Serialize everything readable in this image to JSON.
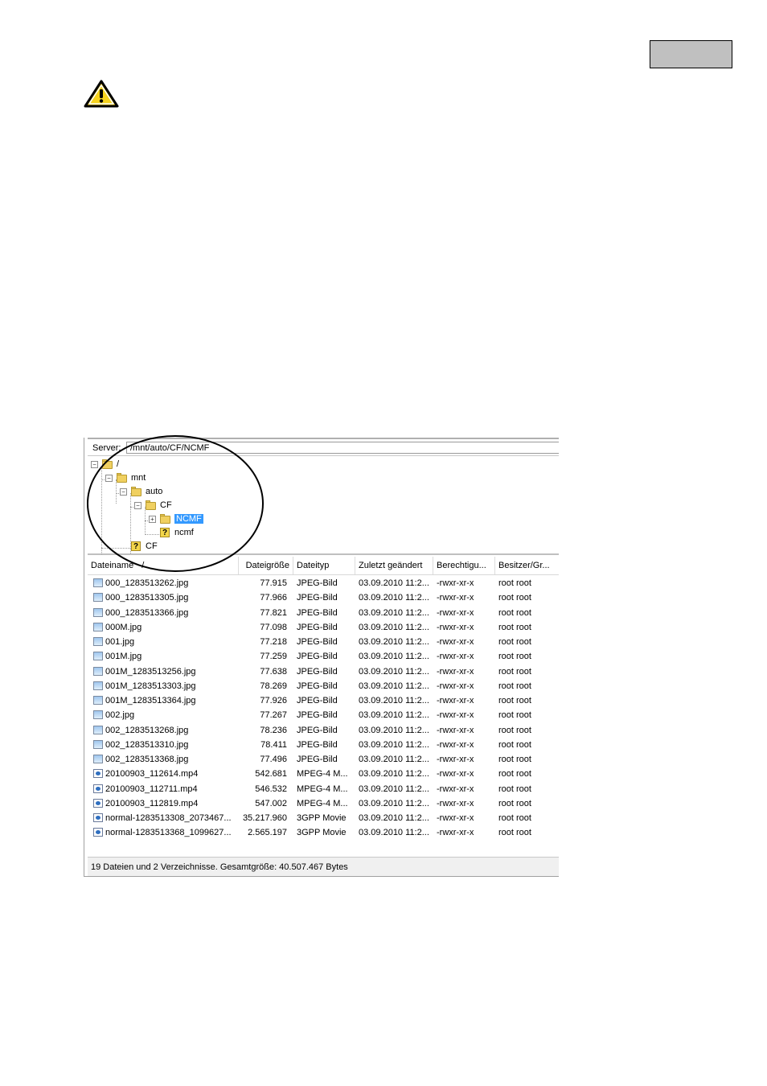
{
  "icons": {
    "warning": "warning-triangle-icon",
    "folder": "folder-icon",
    "unknown": "question-folder-icon",
    "image_file": "image-file-icon",
    "video_file": "video-file-icon"
  },
  "server": {
    "label": "Server:",
    "path": "/mnt/auto/CF/NCMF"
  },
  "tree": [
    {
      "label": "/",
      "icon": "folder"
    },
    {
      "label": "mnt",
      "icon": "folder"
    },
    {
      "label": "auto",
      "icon": "folder"
    },
    {
      "label": "CF",
      "icon": "folder"
    },
    {
      "label": "NCMF",
      "icon": "folder",
      "selected": true
    },
    {
      "label": "ncmf",
      "icon": "unknown"
    },
    {
      "label": "CF",
      "icon": "unknown"
    }
  ],
  "columns": [
    "Dateiname",
    "Dateigröße",
    "Dateityp",
    "Zuletzt geändert",
    "Berechtigu...",
    "Besitzer/Gr..."
  ],
  "sort_indicator": "/",
  "files": [
    {
      "name": "000_1283513262.jpg",
      "size": "77.915",
      "type": "JPEG-Bild",
      "modified": "03.09.2010 11:2...",
      "perm": "-rwxr-xr-x",
      "owner": "root root",
      "icon": "image"
    },
    {
      "name": "000_1283513305.jpg",
      "size": "77.966",
      "type": "JPEG-Bild",
      "modified": "03.09.2010 11:2...",
      "perm": "-rwxr-xr-x",
      "owner": "root root",
      "icon": "image"
    },
    {
      "name": "000_1283513366.jpg",
      "size": "77.821",
      "type": "JPEG-Bild",
      "modified": "03.09.2010 11:2...",
      "perm": "-rwxr-xr-x",
      "owner": "root root",
      "icon": "image"
    },
    {
      "name": "000M.jpg",
      "size": "77.098",
      "type": "JPEG-Bild",
      "modified": "03.09.2010 11:2...",
      "perm": "-rwxr-xr-x",
      "owner": "root root",
      "icon": "image"
    },
    {
      "name": "001.jpg",
      "size": "77.218",
      "type": "JPEG-Bild",
      "modified": "03.09.2010 11:2...",
      "perm": "-rwxr-xr-x",
      "owner": "root root",
      "icon": "image"
    },
    {
      "name": "001M.jpg",
      "size": "77.259",
      "type": "JPEG-Bild",
      "modified": "03.09.2010 11:2...",
      "perm": "-rwxr-xr-x",
      "owner": "root root",
      "icon": "image"
    },
    {
      "name": "001M_1283513256.jpg",
      "size": "77.638",
      "type": "JPEG-Bild",
      "modified": "03.09.2010 11:2...",
      "perm": "-rwxr-xr-x",
      "owner": "root root",
      "icon": "image"
    },
    {
      "name": "001M_1283513303.jpg",
      "size": "78.269",
      "type": "JPEG-Bild",
      "modified": "03.09.2010 11:2...",
      "perm": "-rwxr-xr-x",
      "owner": "root root",
      "icon": "image"
    },
    {
      "name": "001M_1283513364.jpg",
      "size": "77.926",
      "type": "JPEG-Bild",
      "modified": "03.09.2010 11:2...",
      "perm": "-rwxr-xr-x",
      "owner": "root root",
      "icon": "image"
    },
    {
      "name": "002.jpg",
      "size": "77.267",
      "type": "JPEG-Bild",
      "modified": "03.09.2010 11:2...",
      "perm": "-rwxr-xr-x",
      "owner": "root root",
      "icon": "image"
    },
    {
      "name": "002_1283513268.jpg",
      "size": "78.236",
      "type": "JPEG-Bild",
      "modified": "03.09.2010 11:2...",
      "perm": "-rwxr-xr-x",
      "owner": "root root",
      "icon": "image"
    },
    {
      "name": "002_1283513310.jpg",
      "size": "78.411",
      "type": "JPEG-Bild",
      "modified": "03.09.2010 11:2...",
      "perm": "-rwxr-xr-x",
      "owner": "root root",
      "icon": "image"
    },
    {
      "name": "002_1283513368.jpg",
      "size": "77.496",
      "type": "JPEG-Bild",
      "modified": "03.09.2010 11:2...",
      "perm": "-rwxr-xr-x",
      "owner": "root root",
      "icon": "image"
    },
    {
      "name": "20100903_112614.mp4",
      "size": "542.681",
      "type": "MPEG-4 M...",
      "modified": "03.09.2010 11:2...",
      "perm": "-rwxr-xr-x",
      "owner": "root root",
      "icon": "video"
    },
    {
      "name": "20100903_112711.mp4",
      "size": "546.532",
      "type": "MPEG-4 M...",
      "modified": "03.09.2010 11:2...",
      "perm": "-rwxr-xr-x",
      "owner": "root root",
      "icon": "video"
    },
    {
      "name": "20100903_112819.mp4",
      "size": "547.002",
      "type": "MPEG-4 M...",
      "modified": "03.09.2010 11:2...",
      "perm": "-rwxr-xr-x",
      "owner": "root root",
      "icon": "video"
    },
    {
      "name": "normal-1283513308_2073467...",
      "size": "35.217.960",
      "type": "3GPP Movie",
      "modified": "03.09.2010 11:2...",
      "perm": "-rwxr-xr-x",
      "owner": "root root",
      "icon": "video"
    },
    {
      "name": "normal-1283513368_1099627...",
      "size": "2.565.197",
      "type": "3GPP Movie",
      "modified": "03.09.2010 11:2...",
      "perm": "-rwxr-xr-x",
      "owner": "root root",
      "icon": "video"
    }
  ],
  "status": "19 Dateien und 2 Verzeichnisse. Gesamtgröße: 40.507.467 Bytes"
}
